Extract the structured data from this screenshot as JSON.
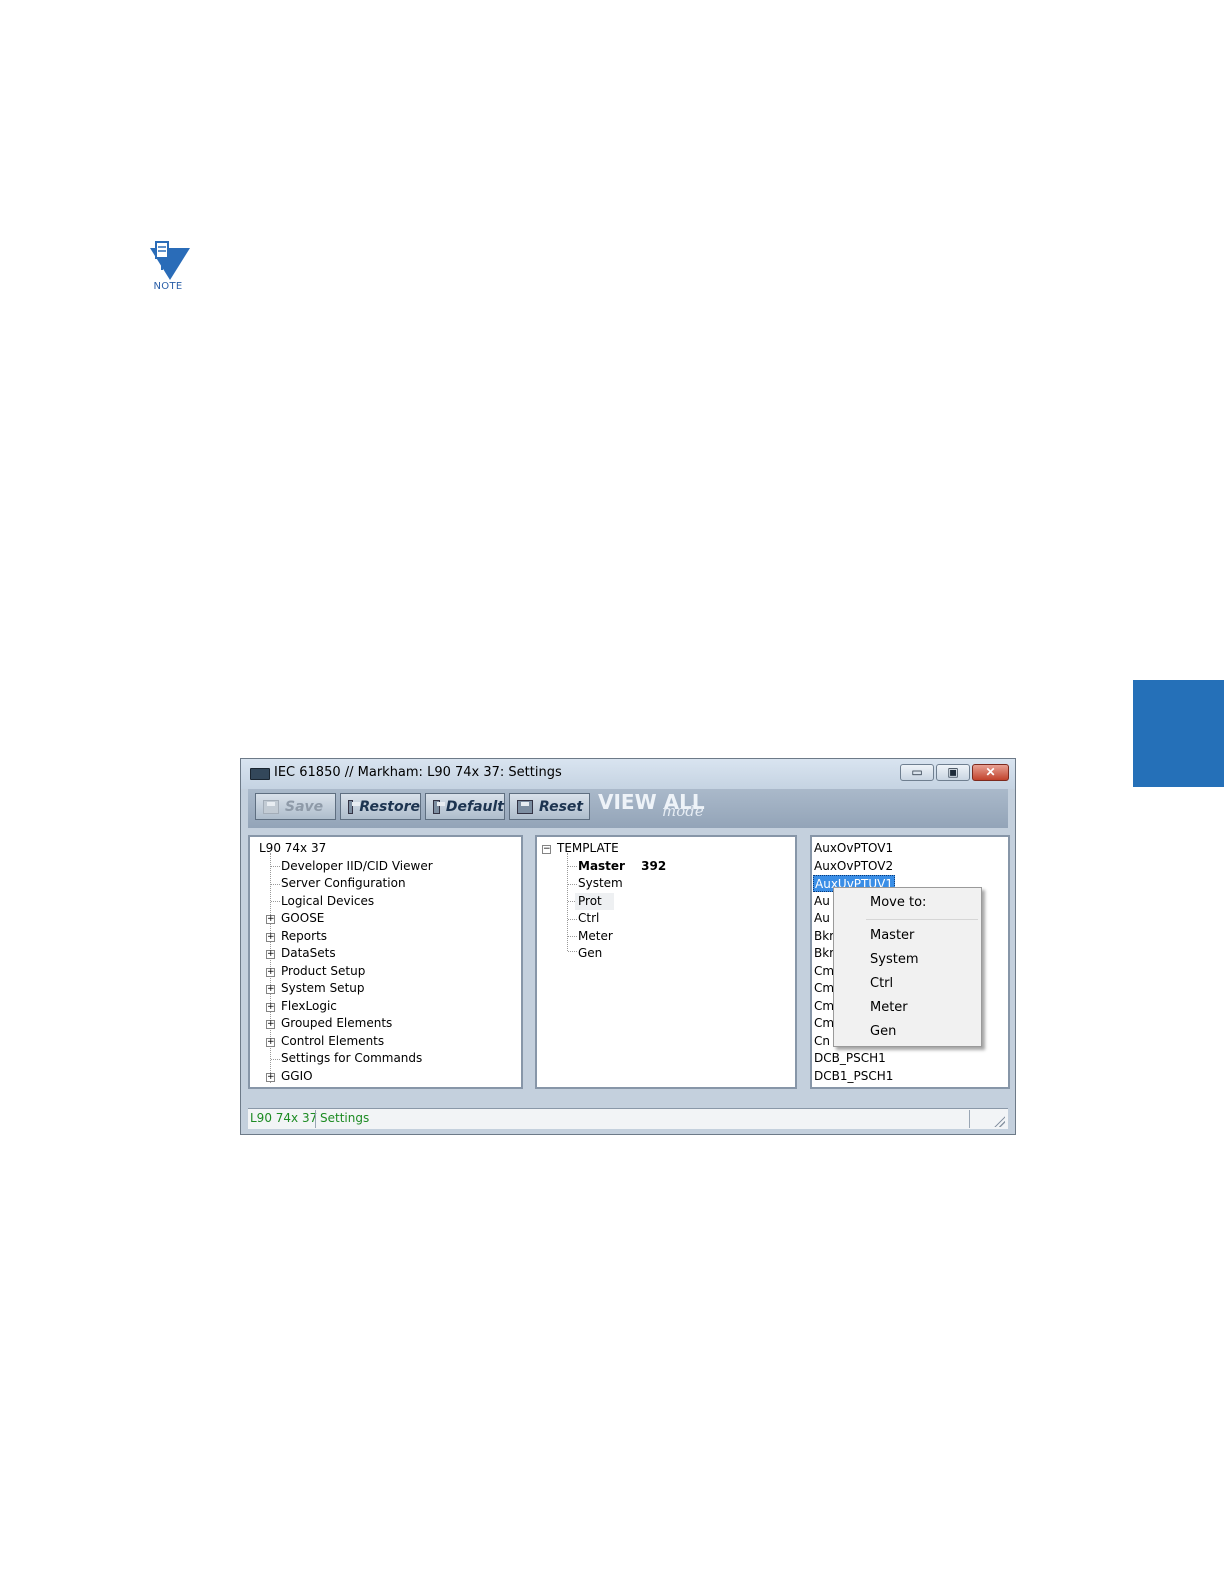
{
  "note": {
    "icon": "note-icon",
    "label": "NOTE"
  },
  "side_tab_color": "#2570b8",
  "window": {
    "title": "IEC 61850 // Markham: L90 74x 37: Settings",
    "controls": {
      "minimize": "▭",
      "maximize": "▣",
      "close": "✕"
    }
  },
  "toolbar": {
    "save": "Save",
    "restore": "Restore",
    "default": "Default",
    "reset": "Reset",
    "view_all": "VIEW ALL",
    "mode": "mode"
  },
  "tree": {
    "root": "L90 74x 37",
    "items": [
      {
        "label": "Developer IID/CID Viewer",
        "expandable": false
      },
      {
        "label": "Server Configuration",
        "expandable": false
      },
      {
        "label": "Logical Devices",
        "expandable": false
      },
      {
        "label": "GOOSE",
        "expandable": true
      },
      {
        "label": "Reports",
        "expandable": true
      },
      {
        "label": "DataSets",
        "expandable": true
      },
      {
        "label": "Product Setup",
        "expandable": true
      },
      {
        "label": "System Setup",
        "expandable": true
      },
      {
        "label": "FlexLogic",
        "expandable": true
      },
      {
        "label": "Grouped Elements",
        "expandable": true
      },
      {
        "label": "Control Elements",
        "expandable": true
      },
      {
        "label": "Settings for Commands",
        "expandable": false
      },
      {
        "label": "GGIO",
        "expandable": true
      }
    ]
  },
  "template": {
    "root": "TEMPLATE",
    "master": "Master",
    "master_count": "392",
    "children": [
      "System",
      "Prot",
      "Ctrl",
      "Meter",
      "Gen"
    ]
  },
  "nodes": {
    "items": [
      "AuxOvPTOV1",
      "AuxOvPTOV2",
      "AuxUvPTUV1",
      "Au",
      "Au",
      "Bkr",
      "Bkr",
      "Cm",
      "Cm",
      "Cm",
      "Cm",
      "Cn",
      "DCB_PSCH1",
      "DCB1_PSCH1"
    ]
  },
  "context_menu": {
    "header": "Move to:",
    "items": [
      "Master",
      "System",
      "Ctrl",
      "Meter",
      "Gen"
    ]
  },
  "status": {
    "device": "L90 74x 37",
    "mode": "Settings"
  }
}
